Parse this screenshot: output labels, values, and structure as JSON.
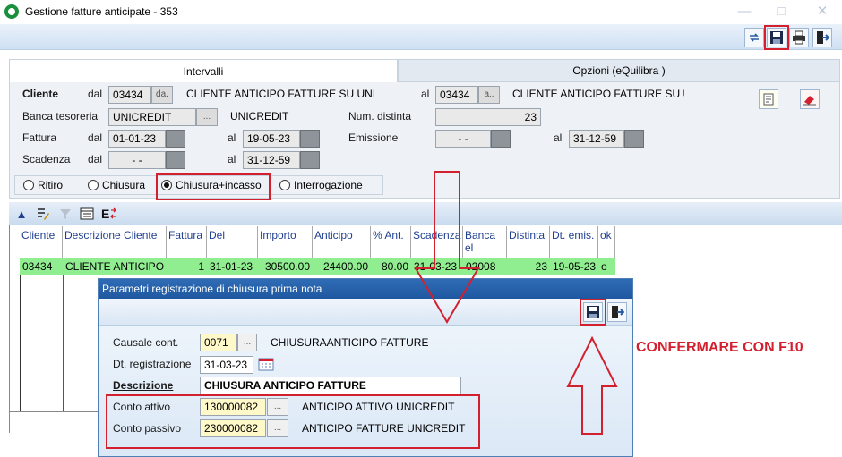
{
  "window": {
    "title": "Gestione fatture anticipate - 353",
    "minimize": "—",
    "maximize": "□",
    "close": "✕"
  },
  "tabs": [
    {
      "label": "Intervalli"
    },
    {
      "label": "Opzioni (eQuilibra )"
    }
  ],
  "filters": {
    "cliente": {
      "label": "Cliente",
      "dal_label": "dal",
      "dal_code": "03434",
      "dal_btn": "da.",
      "dal_name": "CLIENTE ANTICIPO FATTURE SU UNI",
      "al_label": "al",
      "al_code": "03434",
      "al_btn": "a..",
      "al_name": "CLIENTE ANTICIPO FATTURE SU U"
    },
    "banca": {
      "label": "Banca tesoreria",
      "value": "UNICREDIT",
      "btn": "...",
      "name": "UNICREDIT"
    },
    "num_distinta": {
      "label": "Num. distinta",
      "value": "23"
    },
    "fattura": {
      "label": "Fattura",
      "dal_label": "dal",
      "dal": "01-01-23",
      "al_label": "al",
      "al": "19-05-23"
    },
    "emissione": {
      "label": "Emissione",
      "dal": "- -",
      "al_label": "al",
      "al": "31-12-59"
    },
    "scadenza": {
      "label": "Scadenza",
      "dal_label": "dal",
      "dal": "- -",
      "al_label": "al",
      "al": "31-12-59"
    }
  },
  "radio": {
    "options": [
      "Ritiro",
      "Chiusura",
      "Chiusura+incasso",
      "Interrogazione"
    ],
    "selected": "Chiusura+incasso"
  },
  "grid": {
    "columns": [
      "Cliente",
      "Descrizione Cliente",
      "Fattura",
      "Del",
      "Importo",
      "Anticipo",
      "% Ant.",
      "Scadenza",
      "Banca el",
      "Distinta",
      "Dt. emis.",
      "ok"
    ],
    "rows": [
      [
        "03434",
        "CLIENTE ANTICIPO F",
        "1",
        "31-01-23",
        "30500.00",
        "24400.00",
        "80.00",
        "31-03-23",
        "02008",
        "23",
        "19-05-23",
        "o"
      ]
    ]
  },
  "dialog": {
    "title": "Parametri registrazione di chiusura prima nota",
    "causale": {
      "label": "Causale cont.",
      "code": "0071",
      "btn": "...",
      "name": "CHIUSURAANTICIPO FATTURE"
    },
    "data_reg": {
      "label": "Dt. registrazione",
      "value": "31-03-23"
    },
    "descrizione": {
      "label": "Descrizione",
      "value": "CHIUSURA ANTICIPO FATTURE"
    },
    "conto_attivo": {
      "label": "Conto attivo",
      "code": "130000082",
      "btn": "...",
      "name": "ANTICIPO ATTIVO UNICREDIT"
    },
    "conto_passivo": {
      "label": "Conto passivo",
      "code": "230000082",
      "btn": "...",
      "name": "ANTICIPO FATTURE UNICREDIT"
    }
  },
  "annotation": "CONFERMARE CON F10",
  "colors": {
    "accent": "#d3202f",
    "row_highlight": "#90ee90",
    "dialog_title": "#2f6cb5"
  }
}
